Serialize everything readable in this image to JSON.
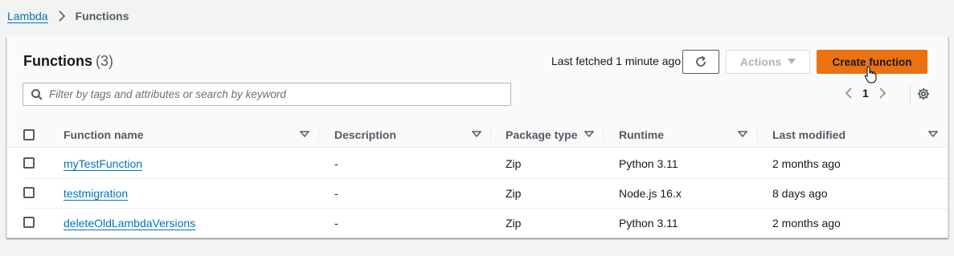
{
  "breadcrumb": {
    "root": "Lambda",
    "current": "Functions"
  },
  "panel": {
    "title": "Functions",
    "count": "(3)",
    "last_fetched": "Last fetched 1 minute ago",
    "refresh_icon": "refresh-icon",
    "actions_label": "Actions",
    "create_label": "Create function",
    "search_placeholder": "Filter by tags and attributes or search by keyword",
    "page_number": "1"
  },
  "table": {
    "headers": {
      "name": "Function name",
      "description": "Description",
      "package": "Package type",
      "runtime": "Runtime",
      "modified": "Last modified"
    },
    "rows": [
      {
        "name": "myTestFunction",
        "description": "-",
        "package": "Zip",
        "runtime": "Python 3.11",
        "modified": "2 months ago"
      },
      {
        "name": "testmigration",
        "description": "-",
        "package": "Zip",
        "runtime": "Node.js 16.x",
        "modified": "8 days ago"
      },
      {
        "name": "deleteOldLambdaVersions",
        "description": "-",
        "package": "Zip",
        "runtime": "Python 3.11",
        "modified": "2 months ago"
      }
    ]
  },
  "colors": {
    "link": "#0073bb",
    "primary_button": "#ec7211",
    "header_bg": "#fafafa",
    "page_bg": "#f2f3f3"
  }
}
